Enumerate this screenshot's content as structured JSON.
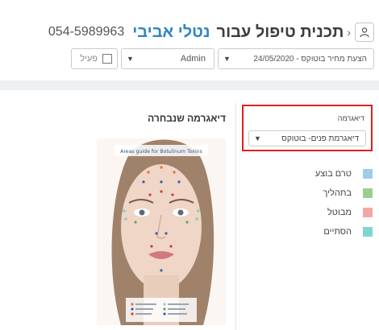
{
  "header": {
    "title": "תכנית טיפול עבור",
    "patient_name": "נטלי אביבי",
    "phone": "054-5989963",
    "icons": {
      "back": "chevron-left-icon",
      "user": "user-icon"
    }
  },
  "controls": {
    "active_label": "פעיל",
    "user_select": "Admin",
    "plan_select": "24/05/2020 - הצעת מחיר בוטוקס"
  },
  "diagram_panel": {
    "label": "דיאגרמה",
    "select_value": "דיאגרמת פנים- בוטוקס"
  },
  "legend": [
    {
      "label": "טרם בוצע",
      "color": "#9ecdea"
    },
    {
      "label": "בתהליך",
      "color": "#9ad08e"
    },
    {
      "label": "מבוטל",
      "color": "#f2a7a7"
    },
    {
      "label": "הסתיים",
      "color": "#7fd6cc"
    }
  ],
  "selected_diagram": {
    "title": "דיאגרמה שנבחרה",
    "image_text": "Areas guide for Botulinum Toxins"
  }
}
